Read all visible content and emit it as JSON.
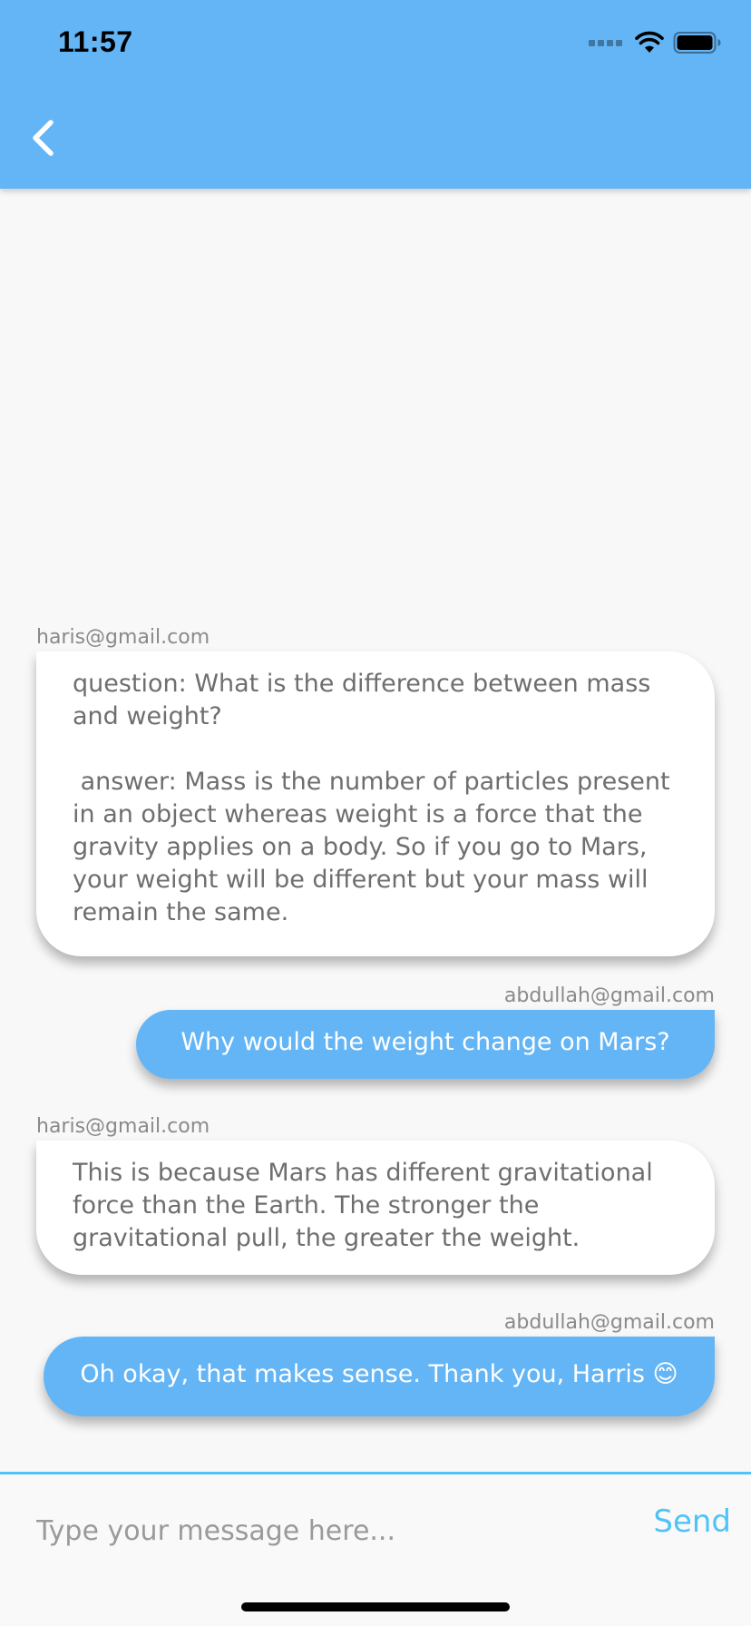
{
  "status_bar": {
    "time": "11:57",
    "icons": [
      "cellular-signal-icon",
      "wifi-icon",
      "battery-icon"
    ]
  },
  "header": {
    "back_icon": "chevron-left-icon"
  },
  "messages": [
    {
      "sender": "haris@gmail.com",
      "direction": "incoming",
      "text": "question: What is the difference between mass and weight?\n\n answer: Mass is the number of particles present in an object whereas weight is a force that the gravity applies on a body. So if you go to Mars, your weight will be different but your mass will remain the same."
    },
    {
      "sender": "abdullah@gmail.com",
      "direction": "outgoing",
      "text": "Why would the weight change on Mars?"
    },
    {
      "sender": "haris@gmail.com",
      "direction": "incoming",
      "text": "This is because Mars has different gravitational force than the Earth. The stronger the gravitational pull, the greater the weight."
    },
    {
      "sender": "abdullah@gmail.com",
      "direction": "outgoing",
      "text": "Oh okay, that makes sense. Thank you, Harris 😊"
    }
  ],
  "composer": {
    "placeholder": "Type your message here...",
    "value": "",
    "send_label": "Send"
  },
  "colors": {
    "app_bar": "#64b5f6",
    "outgoing_bubble": "#64b5f6",
    "incoming_bubble": "#ffffff",
    "accent": "#4fc3f7",
    "background": "#f8f8f8"
  }
}
